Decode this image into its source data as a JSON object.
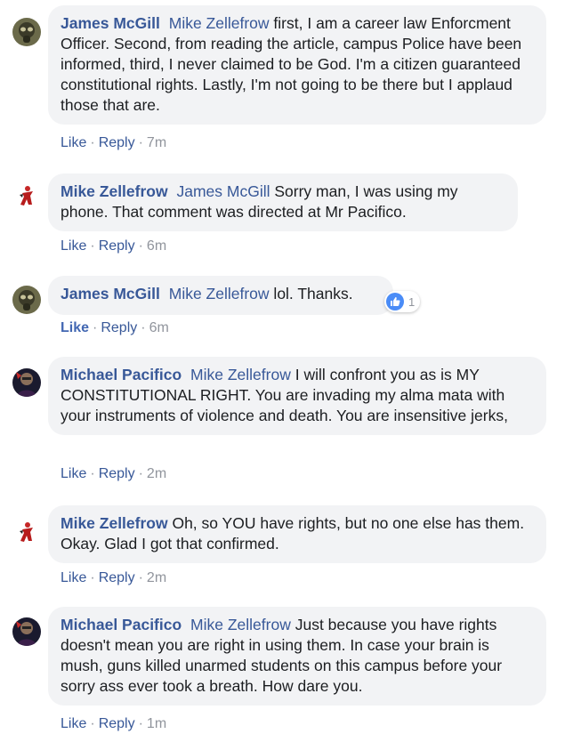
{
  "comments": [
    {
      "author": "James McGill",
      "mention": "Mike Zellefrow",
      "text": " first, I am a career law Enforcment Officer. Second, from reading the article, campus Police have been informed, third, I never claimed to be God. I'm a citizen guaranteed constitutional rights. Lastly, I'm not going to be there but I applaud those that are.",
      "like": "Like",
      "reply": "Reply",
      "time": "7m",
      "avatar_icon": "gas-mask-avatar"
    },
    {
      "author": "Mike Zellefrow",
      "mention": "James McGill",
      "text": " Sorry man, I was using my phone. That comment was directed at Mr Pacifico.",
      "like": "Like",
      "reply": "Reply",
      "time": "6m",
      "avatar_icon": "red-figure-avatar"
    },
    {
      "author": "James McGill",
      "mention": "Mike Zellefrow",
      "text": " lol. Thanks.",
      "like": "Like",
      "reply": "Reply",
      "time": "6m",
      "reaction_count": "1",
      "liked": true,
      "avatar_icon": "gas-mask-avatar"
    },
    {
      "author": "Michael Pacifico",
      "mention": "Mike Zellefrow",
      "text": " I will confront you as is MY CONSTITUTIONAL RIGHT. You are invading my alma mata with your instruments of violence and death. You are insensitive jerks,",
      "like": "Like",
      "reply": "Reply",
      "time": "2m",
      "avatar_icon": "dark-portrait-avatar"
    },
    {
      "author": "Mike Zellefrow",
      "mention": "",
      "text": " Oh, so YOU have rights, but no one else has them. Okay. Glad I got that confirmed.",
      "like": "Like",
      "reply": "Reply",
      "time": "2m",
      "avatar_icon": "red-figure-avatar"
    },
    {
      "author": "Michael Pacifico",
      "mention": "Mike Zellefrow",
      "text": " Just because you have rights doesn't mean you are right in using them. In case your brain is mush, guns killed unarmed students on this campus before your sorry ass ever took a breath. How dare you.",
      "like": "Like",
      "reply": "Reply",
      "time": "1m",
      "avatar_icon": "dark-portrait-avatar"
    }
  ],
  "colors": {
    "link": "#385898",
    "bubble": "#f2f3f5",
    "meta": "#90949c",
    "like_badge": "#4a8cf7"
  }
}
